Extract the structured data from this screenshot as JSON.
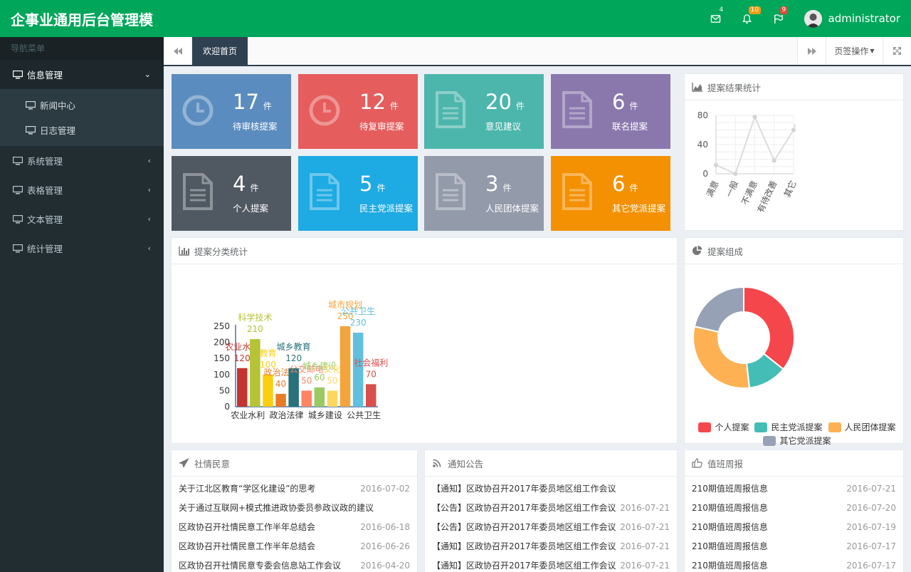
{
  "app": {
    "title": "企事业通用后台管理模"
  },
  "header": {
    "mail_badge": "4",
    "bell_badge": "10",
    "flag_badge": "9",
    "username": "administrator"
  },
  "sidebar": {
    "title": "导航菜单",
    "items": [
      {
        "label": "信息管理",
        "sub": [
          {
            "label": "新闻中心"
          },
          {
            "label": "日志管理"
          }
        ]
      },
      {
        "label": "系统管理"
      },
      {
        "label": "表格管理"
      },
      {
        "label": "文本管理"
      },
      {
        "label": "统计管理"
      }
    ]
  },
  "tabs": {
    "active": "欢迎首页",
    "ops": "页签操作"
  },
  "stats": [
    {
      "num": "17",
      "unit": "件",
      "label": "待审核提案",
      "color": "#5b8cbf"
    },
    {
      "num": "12",
      "unit": "件",
      "label": "待复审提案",
      "color": "#e55d5d"
    },
    {
      "num": "20",
      "unit": "件",
      "label": "意见建议",
      "color": "#4db6ac"
    },
    {
      "num": "6",
      "unit": "件",
      "label": "联名提案",
      "color": "#8a78ad"
    },
    {
      "num": "4",
      "unit": "件",
      "label": "个人提案",
      "color": "#505962"
    },
    {
      "num": "5",
      "unit": "件",
      "label": "民主党派提案",
      "color": "#1eaae2"
    },
    {
      "num": "3",
      "unit": "件",
      "label": "人民团体提案",
      "color": "#939aaa"
    },
    {
      "num": "6",
      "unit": "件",
      "label": "其它党派提案",
      "color": "#f39103"
    }
  ],
  "panels": {
    "result": "提案结果统计",
    "category": "提案分类统计",
    "composition": "提案组成",
    "social": "社情民意",
    "notice": "通知公告",
    "duty": "值班周报"
  },
  "chart_data": [
    {
      "type": "line",
      "title": "",
      "categories": [
        "满意",
        "一般",
        "不满意",
        "有待改善",
        "其它"
      ],
      "values": [
        12,
        0,
        78,
        18,
        60
      ],
      "ylim": [
        0,
        80
      ],
      "yticks": [
        "80",
        "40",
        "0"
      ],
      "color": "#dcdcdc"
    },
    {
      "type": "bar",
      "categories": [
        "农业水利",
        "科学技术",
        "教育",
        "政治法律",
        "城乡教育",
        "公交邮电",
        "城乡建设",
        "文化",
        "城市规划",
        "公共卫生",
        "社会福利"
      ],
      "values": [
        120,
        210,
        100,
        40,
        120,
        50,
        60,
        50,
        250,
        230,
        70
      ],
      "colors": [
        "#c23531",
        "#b5c334",
        "#fcce10",
        "#e87c25",
        "#27727b",
        "#fe8463",
        "#9bca63",
        "#fad860",
        "#f3a43b",
        "#60c0dd",
        "#d7504b"
      ],
      "xtick_labels": [
        "农业水利",
        "政治法律",
        "城乡建设",
        "公共卫生"
      ],
      "yticks": [
        "250",
        "200",
        "150",
        "100",
        "50",
        "0"
      ],
      "ylim": [
        0,
        250
      ]
    },
    {
      "type": "pie",
      "series": [
        {
          "name": "个人提案",
          "value": 4,
          "color": "#f5464c"
        },
        {
          "name": "民主党派提案",
          "value": 1.4,
          "color": "#44bdb6"
        },
        {
          "name": "人民团体提案",
          "value": 3.4,
          "color": "#fdb152"
        },
        {
          "name": "其它党派提案",
          "value": 2.4,
          "color": "#97a1b5"
        }
      ]
    }
  ],
  "lists": {
    "social": [
      {
        "title": "关于江北区教育“学区化建设”的思考",
        "date": "2016-07-02"
      },
      {
        "title": "关于通过互联网+模式推进政协委员参政议政的建议",
        "date": ""
      },
      {
        "title": "区政协召开社情民意工作半年总结会",
        "date": "2016-06-18"
      },
      {
        "title": "区政协召开社情民意工作半年总结会",
        "date": "2016-06-26"
      },
      {
        "title": "区政协召开社情民意专委会信息站工作会议",
        "date": "2016-04-20"
      }
    ],
    "notice": [
      {
        "title": "【通知】区政协召开2017年委员地区组工作会议",
        "date": ""
      },
      {
        "title": "【公告】区政协召开2017年委员地区组工作会议",
        "date": "2016-07-21"
      },
      {
        "title": "【公告】区政协召开2017年委员地区组工作会议",
        "date": "2016-07-21"
      },
      {
        "title": "【通知】区政协召开2017年委员地区组工作会议",
        "date": "2016-07-21"
      },
      {
        "title": "【通知】区政协召开2017年委员地区组工作会议",
        "date": "2016-07-21"
      }
    ],
    "duty": [
      {
        "title": "210期值班周报信息",
        "date": "2016-07-21"
      },
      {
        "title": "210期值班周报信息",
        "date": "2016-07-20"
      },
      {
        "title": "210期值班周报信息",
        "date": "2016-07-19"
      },
      {
        "title": "210期值班周报信息",
        "date": "2016-07-17"
      },
      {
        "title": "210期值班周报信息",
        "date": "2016-07-17"
      }
    ]
  }
}
